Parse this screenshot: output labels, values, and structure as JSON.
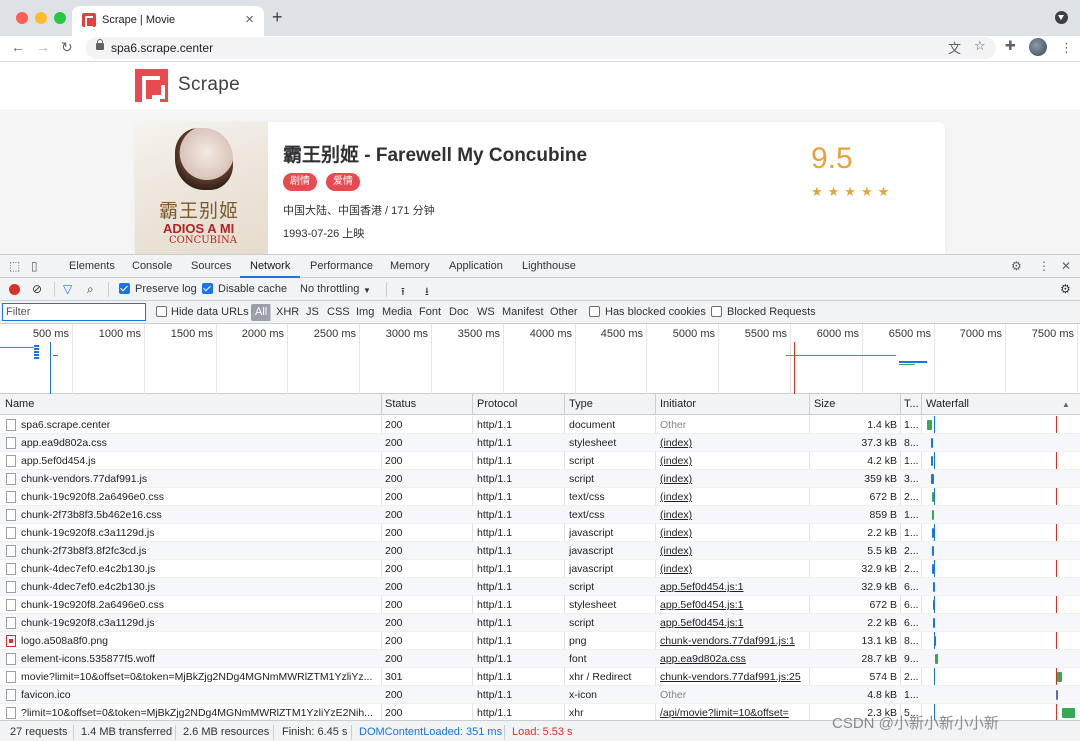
{
  "browser": {
    "tab_title": "Scrape | Movie",
    "url": "spa6.scrape.center",
    "traffic_colors": [
      "#ff5f57",
      "#febc2e",
      "#28c840"
    ]
  },
  "site": {
    "brand": "Scrape",
    "brand_color": "#e84a4f"
  },
  "movie": {
    "title": "霸王别姬 - Farewell My Concubine",
    "tags": [
      "剧情",
      "爱情"
    ],
    "region_duration": "中国大陆、中国香港 / 171 分钟",
    "release": "1993-07-26 上映",
    "score": "9.5",
    "stars": "★★★★★",
    "poster_title": "霸王别姬",
    "poster_line1": "ADIOS A MI",
    "poster_line2": "CONCUBINA"
  },
  "devtools": {
    "tabs": [
      "Elements",
      "Console",
      "Sources",
      "Network",
      "Performance",
      "Memory",
      "Application",
      "Lighthouse"
    ],
    "active_tab": "Network",
    "toolbar": {
      "preserve_log": "Preserve log",
      "disable_cache": "Disable cache",
      "throttling": "No throttling"
    },
    "filter_bar": {
      "placeholder": "Filter",
      "hide_data_urls": "Hide data URLs",
      "all": "All",
      "types": [
        "XHR",
        "JS",
        "CSS",
        "Img",
        "Media",
        "Font",
        "Doc",
        "WS",
        "Manifest",
        "Other"
      ],
      "blocked_cookies": "Has blocked cookies",
      "blocked_requests": "Blocked Requests"
    },
    "overview_ticks": [
      "500 ms",
      "1000 ms",
      "1500 ms",
      "2000 ms",
      "2500 ms",
      "3000 ms",
      "3500 ms",
      "4000 ms",
      "4500 ms",
      "5000 ms",
      "5500 ms",
      "6000 ms",
      "6500 ms",
      "7000 ms",
      "7500 ms"
    ],
    "columns": [
      "Name",
      "Status",
      "Protocol",
      "Type",
      "Initiator",
      "Size",
      "T...",
      "Waterfall"
    ],
    "sort_indicator": "▲",
    "rows": [
      {
        "name": "spa6.scrape.center",
        "status": "200",
        "protocol": "http/1.1",
        "type": "document",
        "initiator": "Other",
        "size": "1.4 kB",
        "time": "1..."
      },
      {
        "name": "app.ea9d802a.css",
        "status": "200",
        "protocol": "http/1.1",
        "type": "stylesheet",
        "initiator": "(index)",
        "size": "37.3 kB",
        "time": "8..."
      },
      {
        "name": "app.5ef0d454.js",
        "status": "200",
        "protocol": "http/1.1",
        "type": "script",
        "initiator": "(index)",
        "size": "4.2 kB",
        "time": "1..."
      },
      {
        "name": "chunk-vendors.77daf991.js",
        "status": "200",
        "protocol": "http/1.1",
        "type": "script",
        "initiator": "(index)",
        "size": "359 kB",
        "time": "3..."
      },
      {
        "name": "chunk-19c920f8.2a6496e0.css",
        "status": "200",
        "protocol": "http/1.1",
        "type": "text/css",
        "initiator": "(index)",
        "size": "672 B",
        "time": "2..."
      },
      {
        "name": "chunk-2f73b8f3.5b462e16.css",
        "status": "200",
        "protocol": "http/1.1",
        "type": "text/css",
        "initiator": "(index)",
        "size": "859 B",
        "time": "1..."
      },
      {
        "name": "chunk-19c920f8.c3a1129d.js",
        "status": "200",
        "protocol": "http/1.1",
        "type": "javascript",
        "initiator": "(index)",
        "size": "2.2 kB",
        "time": "1..."
      },
      {
        "name": "chunk-2f73b8f3.8f2fc3cd.js",
        "status": "200",
        "protocol": "http/1.1",
        "type": "javascript",
        "initiator": "(index)",
        "size": "5.5 kB",
        "time": "2..."
      },
      {
        "name": "chunk-4dec7ef0.e4c2b130.js",
        "status": "200",
        "protocol": "http/1.1",
        "type": "javascript",
        "initiator": "(index)",
        "size": "32.9 kB",
        "time": "2..."
      },
      {
        "name": "chunk-4dec7ef0.e4c2b130.js",
        "status": "200",
        "protocol": "http/1.1",
        "type": "script",
        "initiator": "app.5ef0d454.js:1",
        "size": "32.9 kB",
        "time": "6..."
      },
      {
        "name": "chunk-19c920f8.2a6496e0.css",
        "status": "200",
        "protocol": "http/1.1",
        "type": "stylesheet",
        "initiator": "app.5ef0d454.js:1",
        "size": "672 B",
        "time": "6..."
      },
      {
        "name": "chunk-19c920f8.c3a1129d.js",
        "status": "200",
        "protocol": "http/1.1",
        "type": "script",
        "initiator": "app.5ef0d454.js:1",
        "size": "2.2 kB",
        "time": "6..."
      },
      {
        "name": "logo.a508a8f0.png",
        "status": "200",
        "protocol": "http/1.1",
        "type": "png",
        "initiator": "chunk-vendors.77daf991.js:1",
        "size": "13.1 kB",
        "time": "8..."
      },
      {
        "name": "element-icons.535877f5.woff",
        "status": "200",
        "protocol": "http/1.1",
        "type": "font",
        "initiator": "app.ea9d802a.css",
        "size": "28.7 kB",
        "time": "9..."
      },
      {
        "name": "movie?limit=10&offset=0&token=MjBkZjg2NDg4MGNmMWRlZTM1YzliYz...",
        "status": "301",
        "protocol": "http/1.1",
        "type": "xhr / Redirect",
        "initiator": "chunk-vendors.77daf991.js:25",
        "size": "574 B",
        "time": "2..."
      },
      {
        "name": "favicon.ico",
        "status": "200",
        "protocol": "http/1.1",
        "type": "x-icon",
        "initiator": "Other",
        "size": "4.8 kB",
        "time": "1..."
      },
      {
        "name": "?limit=10&offset=0&token=MjBkZjg2NDg4MGNmMWRlZTM1YzliYzE2Nih...",
        "status": "200",
        "protocol": "http/1.1",
        "type": "xhr",
        "initiator": "/api/movie?limit=10&offset=",
        "size": "2.3 kB",
        "time": "5..."
      }
    ],
    "status_bar": {
      "requests": "27 requests",
      "transferred": "1.4 MB transferred",
      "resources": "2.6 MB resources",
      "finish": "Finish: 6.45 s",
      "dom_content_loaded": "DOMContentLoaded: 351 ms",
      "load": "Load: 5.53 s"
    },
    "watermark": "CSDN @小新小新小小新",
    "colors": {
      "accent": "#1a73e8",
      "record": "#d93025"
    }
  }
}
